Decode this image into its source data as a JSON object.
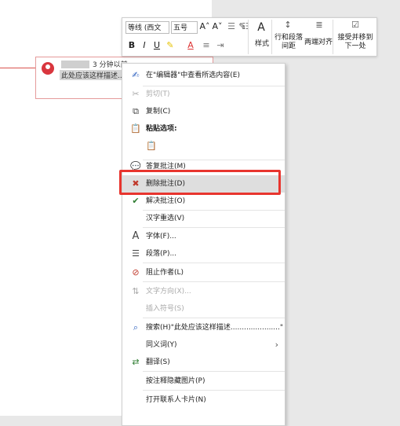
{
  "document": {
    "comment": {
      "time": "3 分钟以前",
      "text": "此处应该这样描述......"
    }
  },
  "toolbar": {
    "font_name": "等线 (西文",
    "font_size": "五号",
    "grow_font": "A˄",
    "shrink_font": "A˅",
    "bold": "B",
    "italic": "I",
    "underline": "U",
    "font_color": "A",
    "style_label": "样式",
    "line_spacing_label": "行和段落间距",
    "justify_label": "两端对齐",
    "accept_label": "接受并移到下一处"
  },
  "menu": {
    "items": [
      {
        "label": "在\"编辑器\"中查看所选内容(E)",
        "icon": "editor-icon",
        "disabled": false
      },
      {
        "label": "剪切(T)",
        "icon": "scissors-icon",
        "disabled": true
      },
      {
        "label": "复制(C)",
        "icon": "copy-icon",
        "disabled": false
      },
      {
        "label": "粘贴选项:",
        "icon": "paste-icon",
        "disabled": false
      },
      {
        "label": "",
        "icon": "paste-keep-text-icon",
        "disabled": true
      },
      {
        "label": "答复批注(M)",
        "icon": "reply-comment-icon",
        "disabled": false
      },
      {
        "label": "删除批注(D)",
        "icon": "delete-comment-icon",
        "disabled": false
      },
      {
        "label": "解决批注(O)",
        "icon": "resolve-comment-icon",
        "disabled": false
      },
      {
        "label": "汉字重选(V)",
        "icon": "",
        "disabled": false
      },
      {
        "label": "字体(F)...",
        "icon": "font-icon",
        "disabled": false
      },
      {
        "label": "段落(P)...",
        "icon": "paragraph-icon",
        "disabled": false
      },
      {
        "label": "阻止作者(L)",
        "icon": "block-author-icon",
        "disabled": false
      },
      {
        "label": "文字方向(X)...",
        "icon": "text-direction-icon",
        "disabled": true
      },
      {
        "label": "插入符号(S)",
        "icon": "",
        "disabled": true
      },
      {
        "label": "搜索(H)\"此处应该这样描述......................\"",
        "icon": "search-icon",
        "disabled": false
      },
      {
        "label": "同义词(Y)",
        "icon": "",
        "disabled": false
      },
      {
        "label": "翻译(S)",
        "icon": "translate-icon",
        "disabled": false
      },
      {
        "label": "按注释隐藏图片(P)",
        "icon": "",
        "disabled": false
      },
      {
        "label": "打开联系人卡片(N)",
        "icon": "",
        "disabled": false
      }
    ]
  }
}
